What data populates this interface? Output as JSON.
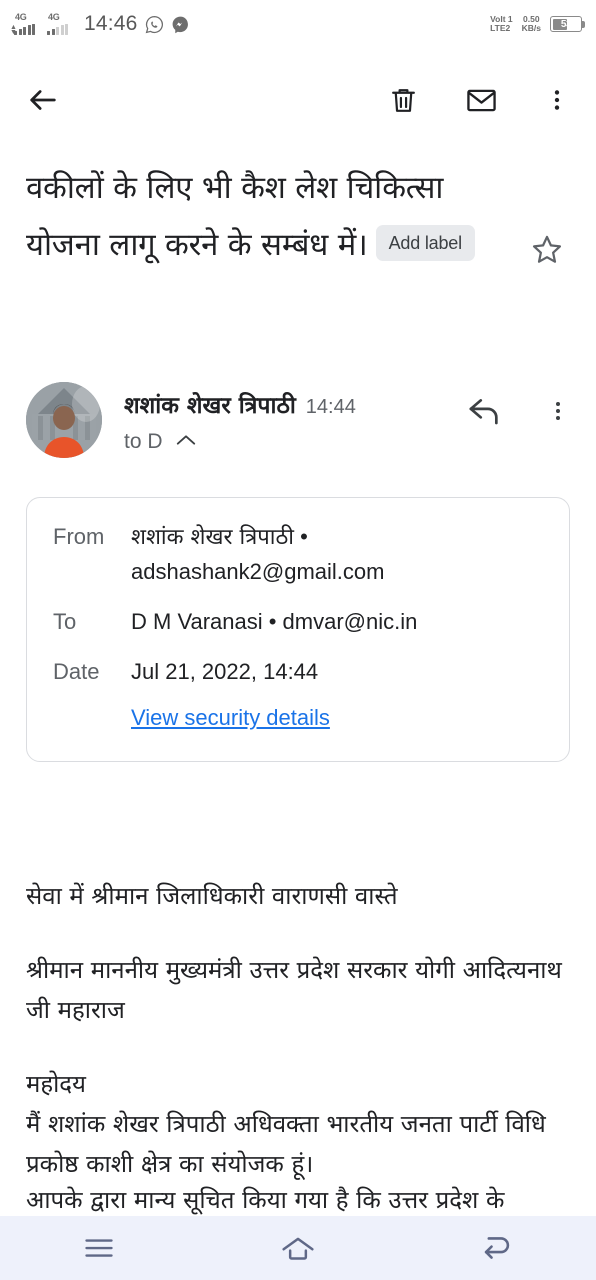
{
  "statusbar": {
    "network_1": "4G",
    "network_2": "4G",
    "time": "14:46",
    "whatsapp_icon": "whatsapp-icon",
    "messenger_icon": "messenger-icon",
    "volte_label_line1": "VoIt 1",
    "volte_label_line2": "LTE2",
    "speed_value": "0.50",
    "speed_unit": "KB/s",
    "battery_percent": "53"
  },
  "toolbar": {
    "back_icon": "back-arrow-icon",
    "delete_icon": "trash-icon",
    "mark_unread_icon": "envelope-icon",
    "overflow_icon": "more-vert-icon"
  },
  "email": {
    "subject": "वकीलों के लिए भी कैश लेश चिकित्सा योजना लागू करने के सम्बंध में।",
    "add_label": "Add label",
    "star_icon": "star-outline-icon",
    "sender_name": "शशांक शेखर त्रिपाठी",
    "sent_time": "14:44",
    "to_summary": "to D",
    "collapse_icon": "chevron-up-icon",
    "reply_icon": "reply-arrow-icon",
    "message_overflow_icon": "more-vert-icon",
    "avatar": "sender-avatar-photo"
  },
  "details": {
    "from_label": "From",
    "from_name": "शशांक शेखर त्रिपाठी",
    "from_separator": " • ",
    "from_email": "adshashank2@gmail.com",
    "to_label": "To",
    "to_value": "D M Varanasi • dmvar@nic.in",
    "date_label": "Date",
    "date_value": "Jul 21, 2022, 14:44",
    "security_link": "View security details"
  },
  "body": {
    "line_1": "सेवा में श्रीमान जिलाधिकारी वाराणसी वास्ते",
    "line_2": "श्रीमान माननीय मुख्यमंत्री उत्तर प्रदेश सरकार योगी आदित्यनाथ जी महाराज",
    "line_3": " महोदय",
    "line_4": "मैं शशांक शेखर त्रिपाठी अधिवक्ता भारतीय जनता पार्टी विधि प्रकोष्ठ काशी क्षेत्र का संयोजक हूं।",
    "line_5_clipped": "आपके द्वारा मान्य सूचित किया गया है कि उत्तर प्रदेश के"
  },
  "navbar": {
    "recents_icon": "recents-menu-icon",
    "home_icon": "home-icon",
    "back_icon": "back-nav-icon"
  },
  "colors": {
    "link": "#1a73e8",
    "chip_bg": "#e8eaed",
    "text_primary": "#202124",
    "text_secondary": "#5f6368",
    "navbar_bg": "#eef1fb"
  }
}
